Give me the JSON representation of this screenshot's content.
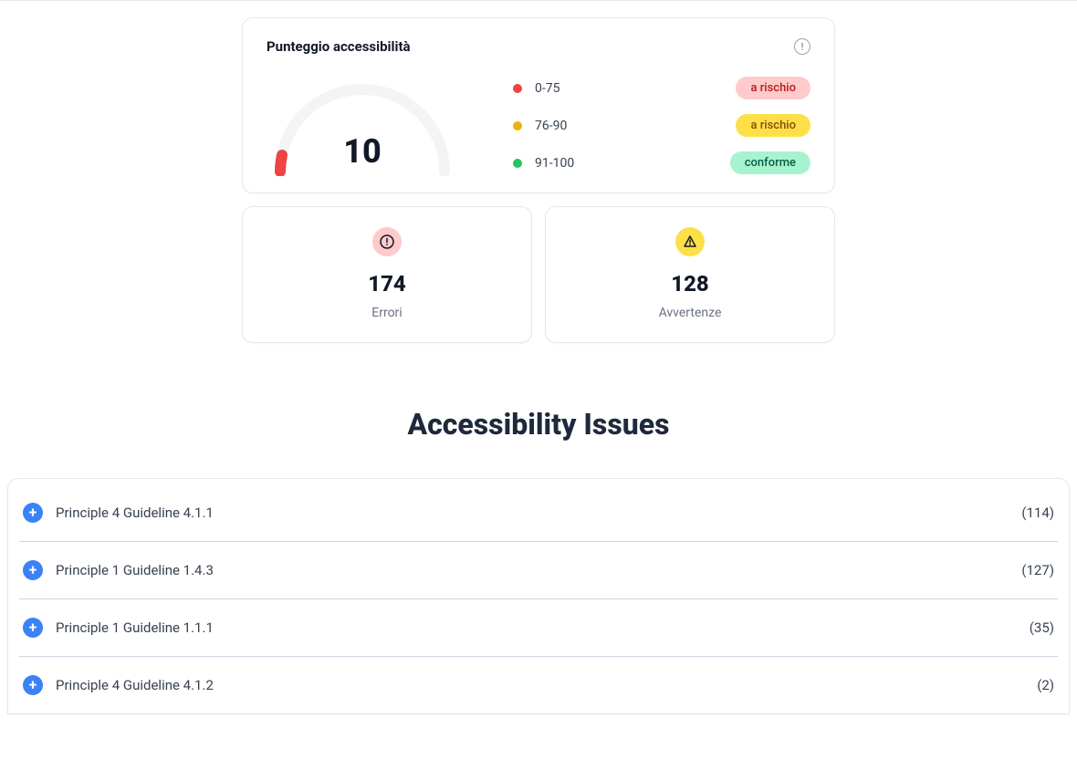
{
  "scoreCard": {
    "title": "Punteggio accessibilità",
    "value": "10",
    "legend": [
      {
        "range": "0-75",
        "label": "a rischio"
      },
      {
        "range": "76-90",
        "label": "a rischio"
      },
      {
        "range": "91-100",
        "label": "conforme"
      }
    ]
  },
  "stats": {
    "errors": {
      "value": "174",
      "label": "Errori"
    },
    "warnings": {
      "value": "128",
      "label": "Avvertenze"
    }
  },
  "issues": {
    "title": "Accessibility Issues",
    "rows": [
      {
        "label": "Principle 4 Guideline 4.1.1",
        "count": "(114)"
      },
      {
        "label": "Principle 1 Guideline 1.4.3",
        "count": "(127)"
      },
      {
        "label": "Principle 1 Guideline 1.1.1",
        "count": "(35)"
      },
      {
        "label": "Principle 4 Guideline 4.1.2",
        "count": "(2)"
      }
    ]
  }
}
